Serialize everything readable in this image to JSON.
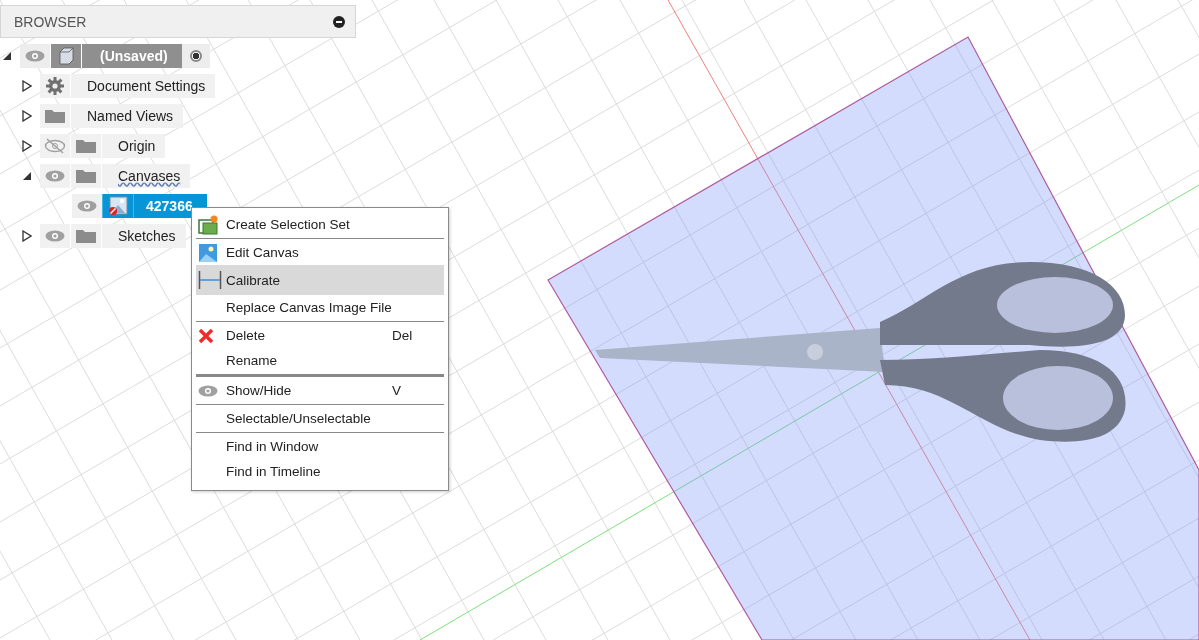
{
  "browser": {
    "title": "BROWSER",
    "tree": [
      {
        "label": "(Unsaved)",
        "kind": "component",
        "visible": true,
        "expanded": true,
        "selected": false,
        "active": true,
        "children": [
          {
            "label": "Document Settings",
            "kind": "settings",
            "expanded": false,
            "selected": false
          },
          {
            "label": "Named Views",
            "kind": "folder",
            "expanded": false,
            "selected": false
          },
          {
            "label": "Origin",
            "kind": "folder",
            "visible": false,
            "expanded": false,
            "selected": false
          },
          {
            "label": "Canvases",
            "kind": "folder",
            "visible": true,
            "expanded": true,
            "selected": false,
            "children": [
              {
                "label": "427366",
                "kind": "canvas",
                "visible": true,
                "selected": true
              }
            ]
          },
          {
            "label": "Sketches",
            "kind": "folder",
            "visible": true,
            "expanded": false,
            "selected": false
          }
        ]
      }
    ]
  },
  "context_menu": {
    "groups": [
      [
        {
          "label": "Create Selection Set",
          "kind": "selection-set",
          "selected": false
        }
      ],
      [
        {
          "label": "Edit Canvas",
          "kind": "image",
          "selected": false
        },
        {
          "label": "Calibrate",
          "kind": "calibrate",
          "selected": true
        },
        {
          "label": "Replace Canvas Image File",
          "selected": false
        }
      ],
      [
        {
          "label": "Delete",
          "kind": "delete",
          "shortcut": "Del",
          "selected": false
        },
        {
          "label": "Rename",
          "selected": false
        }
      ],
      [
        {
          "label": "Show/Hide",
          "kind": "eye",
          "shortcut": "V",
          "selected": false
        }
      ],
      [
        {
          "label": "Selectable/Unselectable",
          "selected": false
        }
      ],
      [
        {
          "label": "Find in Window",
          "selected": false
        },
        {
          "label": "Find in Timeline",
          "selected": false
        }
      ]
    ]
  }
}
